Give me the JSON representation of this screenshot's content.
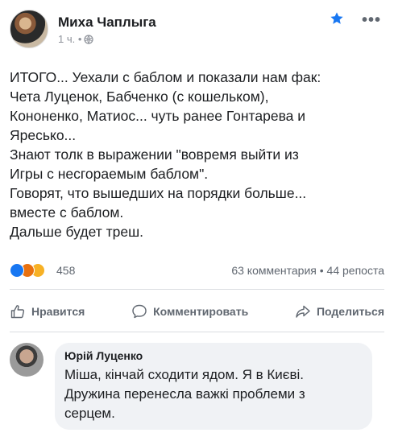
{
  "post": {
    "author": "Миха Чаплыга",
    "time": "1 ч. •",
    "lines": [
      "ИТОГО... Уехали с баблом и показали нам фак:",
      "Чета Луценок, Бабченко (с кошельком),",
      "Кононенко, Матиос... чуть ранее Гонтарева и",
      "Яресько...",
      "Знают толк в выражении \"вовремя выйти из",
      "Игры с несгораемым баблом\".",
      "Говорят, что вышедших на порядки больше...",
      "вместе с баблом.",
      "Дальше будет треш."
    ],
    "reaction_count": "458",
    "counts": "63 комментария • 44 репоста"
  },
  "actions": {
    "like": "Нравится",
    "comment": "Комментировать",
    "share": "Поделиться"
  },
  "comment": {
    "author": "Юрій Луценко",
    "lines": [
      "Міша, кінчай сходити ядом. Я в Києві.",
      "Дружина перенесла важкі проблеми з",
      "серцем."
    ]
  },
  "colors": {
    "accent": "#1877f2",
    "muted": "#606770",
    "bubble": "#f0f2f5"
  },
  "icons": [
    "globe-icon",
    "star-icon",
    "more-icon",
    "like-icon",
    "comment-icon",
    "share-icon"
  ]
}
